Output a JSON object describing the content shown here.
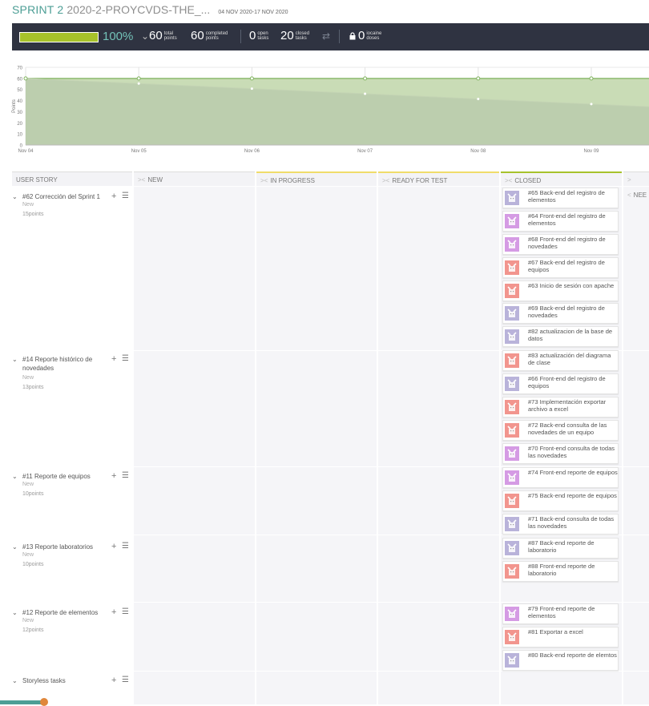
{
  "header": {
    "sprint_name": "SPRINT 2",
    "project_slug": "2020-2-PROYCVDS-THE_...",
    "dates": "04 NOV 2020-17 NOV 2020"
  },
  "stats": {
    "progress_fraction": 1.0,
    "progress_color": "#a7c22b",
    "percent": "100%",
    "total_points": {
      "value": "60",
      "label_1": "total",
      "label_2": "points"
    },
    "completed_points": {
      "value": "60",
      "label_1": "completed",
      "label_2": "points"
    },
    "open_tasks": {
      "value": "0",
      "label_1": "open",
      "label_2": "tasks"
    },
    "closed_tasks": {
      "value": "20",
      "label_1": "closed",
      "label_2": "tasks"
    },
    "iocaine": {
      "value": "0",
      "label_1": "iocaine",
      "label_2": "doses"
    }
  },
  "chart_data": {
    "type": "area",
    "x": [
      "Nov 04",
      "Nov 05",
      "Nov 06",
      "Nov 07",
      "Nov 08",
      "Nov 09"
    ],
    "ylabel": "Points",
    "ylim": [
      0,
      70
    ],
    "yticks": [
      "0",
      "10",
      "20",
      "30",
      "40",
      "50",
      "60",
      "70"
    ],
    "series": [
      {
        "values": [
          60,
          60,
          60,
          60,
          60,
          60
        ],
        "color": "#7fb35d"
      },
      {
        "values": [
          60,
          55.4,
          50.8,
          46.2,
          41.5,
          36.9
        ],
        "color": "#cfe0b8"
      }
    ]
  },
  "columns": {
    "user_story": "USER STORY",
    "new": "NEW",
    "in_progress": "IN PROGRESS",
    "ready_for_test": "READY FOR TEST",
    "closed": "CLOSED",
    "needs": "NEE"
  },
  "stories": [
    {
      "title": "#62 Corrección del Sprint 1",
      "status": "New",
      "points": "15points"
    },
    {
      "title": "#14 Reporte histórico de novedades",
      "status": "New",
      "points": "13points"
    },
    {
      "title": "#11 Reporte de equipos",
      "status": "New",
      "points": "10points"
    },
    {
      "title": "#13 Reporte laboratorios",
      "status": "New",
      "points": "10points"
    },
    {
      "title": "#12 Reporte de elementos",
      "status": "New",
      "points": "12points"
    },
    {
      "title": "Storyless tasks"
    }
  ],
  "tasks": [
    {
      "title": "#65 Back-end del registro de elementos",
      "avatar": "#b9b3da"
    },
    {
      "title": "#64 Front-end del registro de elementos",
      "avatar": "#d59be4"
    },
    {
      "title": "#68 Front-end del registro de novedades",
      "avatar": "#d59be4"
    },
    {
      "title": "#67 Back-end del registro de equipos",
      "avatar": "#f2958e"
    },
    {
      "title": "#63 Inicio de sesión con apache",
      "avatar": "#f2958e"
    },
    {
      "title": "#69 Back-end del registro de novedades",
      "avatar": "#b9b3da"
    },
    {
      "title": "#82 actualizacion de la base de datos",
      "avatar": "#b9b3da"
    },
    {
      "title": "#83 actualización del diagrama de clase",
      "avatar": "#f2958e"
    },
    {
      "title": "#66 Front-end del registro de equipos",
      "avatar": "#b9b3da"
    },
    {
      "title": "#73 Implementación exportar archivo a excel",
      "avatar": "#f2958e"
    },
    {
      "title": "#72 Back-end consulta de las novedades de un equipo",
      "avatar": "#f2958e"
    },
    {
      "title": "#70 Front-end consulta de todas las novedades",
      "avatar": "#d59be4"
    },
    {
      "title": "#74 Front-end reporte de equipos",
      "avatar": "#d59be4"
    },
    {
      "title": "#75 Back-end reporte de equipos",
      "avatar": "#f2958e"
    },
    {
      "title": "#71 Back-end consulta de todas las novedades",
      "avatar": "#b9b3da"
    },
    {
      "title": "#87 Back-end reporte de laboratorio",
      "avatar": "#b9b3da"
    },
    {
      "title": "#88 Front-end reporte de laboratorio",
      "avatar": "#f2958e"
    },
    {
      "title": "#79 Front-end reporte de elementos",
      "avatar": "#d59be4"
    },
    {
      "title": "#81 Exportar a excel",
      "avatar": "#f2958e"
    },
    {
      "title": "#80 Back-end reporte de elemtos",
      "avatar": "#b9b3da"
    }
  ]
}
